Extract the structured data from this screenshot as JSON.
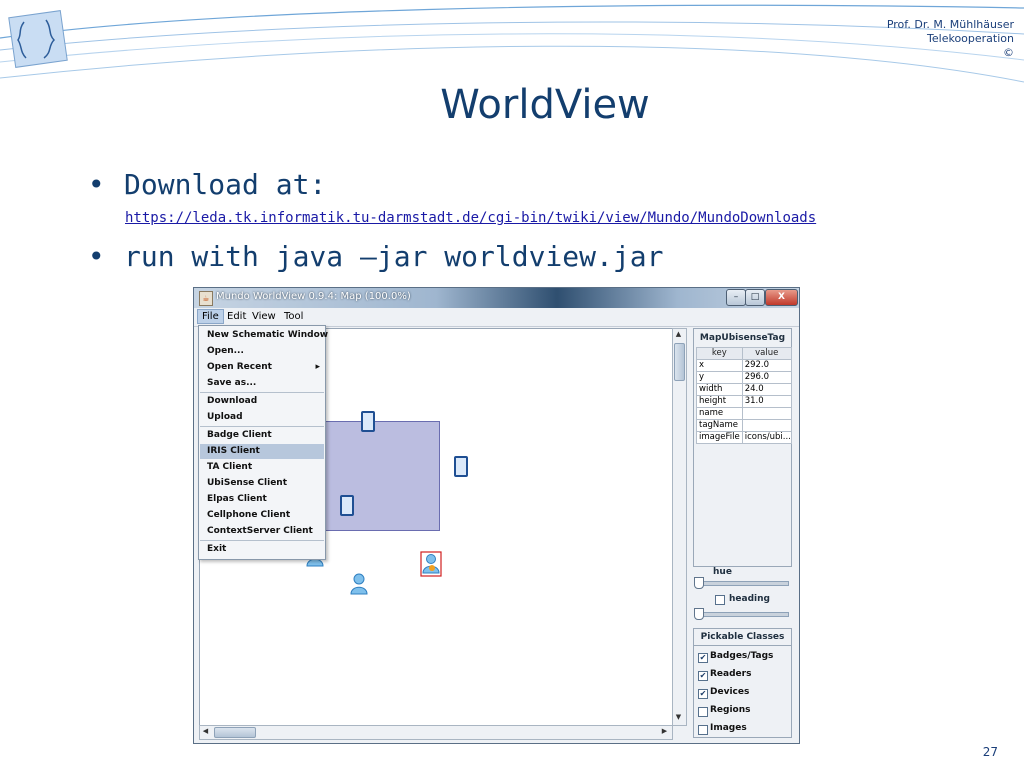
{
  "author": {
    "line1": "Prof. Dr. M. Mühlhäuser",
    "line2": "Telekooperation",
    "line3": "©"
  },
  "slide": {
    "title": "WorldView",
    "page_number": "27"
  },
  "bullets": [
    {
      "text": "Download at:",
      "link": "https://leda.tk.informatik.tu-darmstadt.de/cgi-bin/twiki/view/Mundo/MundoDownloads"
    },
    {
      "text": "run with java –jar worldview.jar"
    }
  ],
  "window": {
    "title": "Mundo WorldView 0.9.4: Map (100.0%)",
    "min": "–",
    "max": "□",
    "close": "X"
  },
  "menubar": [
    "File",
    "Edit",
    "View",
    "Tool"
  ],
  "file_menu": {
    "items": [
      "New Schematic Window",
      "Open...",
      "Open Recent",
      "Save as...",
      "Download",
      "Upload",
      "Badge Client",
      "IRIS Client",
      "TA Client",
      "UbiSense Client",
      "Elpas Client",
      "Cellphone Client",
      "ContextServer Client",
      "Exit"
    ],
    "selected": "IRIS Client",
    "submenu_arrow": "▸"
  },
  "side_panel": {
    "title": "MapUbisenseTag",
    "columns": [
      "key",
      "value"
    ],
    "rows": [
      [
        "x",
        "292.0"
      ],
      [
        "y",
        "296.0"
      ],
      [
        "width",
        "24.0"
      ],
      [
        "height",
        "31.0"
      ],
      [
        "name",
        ""
      ],
      [
        "tagName",
        ""
      ],
      [
        "imageFile",
        "icons/ubi..."
      ]
    ],
    "hue_label": "hue",
    "heading_label": "heading",
    "pickable_title": "Pickable Classes",
    "pickable": [
      {
        "label": "Badges/Tags",
        "checked": true
      },
      {
        "label": "Readers",
        "checked": true
      },
      {
        "label": "Devices",
        "checked": true
      },
      {
        "label": "Regions",
        "checked": false
      },
      {
        "label": "Images",
        "checked": false
      }
    ],
    "check_mark": "✔"
  },
  "scroll": {
    "up": "▲",
    "down": "▼",
    "left": "◀",
    "right": "▶"
  },
  "icons": {
    "java": "java-cup-icon",
    "reader": "reader-device-icon",
    "person": "person-badge-icon"
  }
}
